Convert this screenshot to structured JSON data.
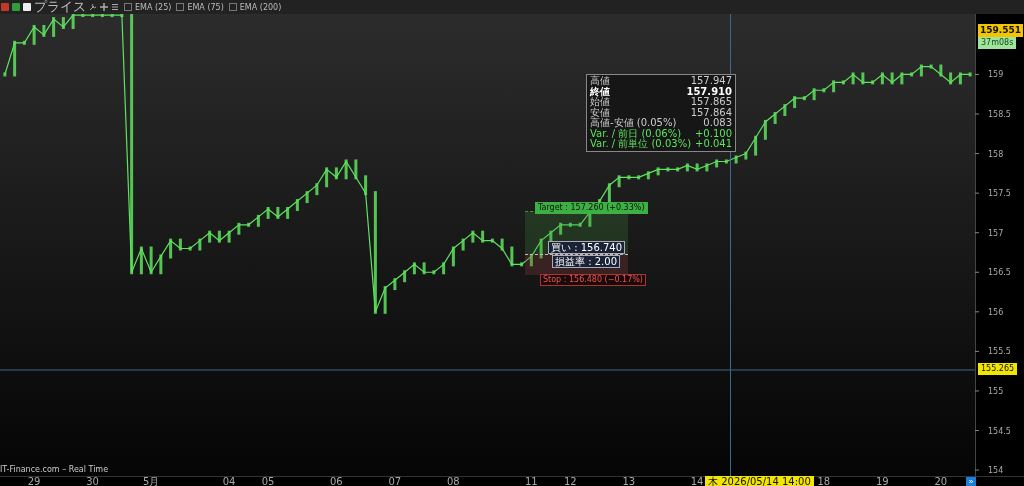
{
  "toolbar": {
    "indicators": [
      {
        "label": "EMA (25)",
        "checked": false
      },
      {
        "label": "EMA (75)",
        "checked": false
      },
      {
        "label": "EMA (200)",
        "checked": false
      }
    ]
  },
  "chart": {
    "chart_data": {
      "type": "line",
      "ylim": [
        153.925,
        159.764
      ],
      "ref_lines": [
        {
          "axis": "y",
          "value": 155.265
        }
      ],
      "yticks": [
        154,
        154.5,
        155,
        155.5,
        156,
        156.5,
        157,
        157.5,
        158,
        158.5,
        159
      ],
      "categories": [
        null,
        null,
        null,
        "29",
        null,
        null,
        null,
        null,
        null,
        "30",
        null,
        null,
        null,
        null,
        null,
        "5月",
        null,
        null,
        null,
        null,
        null,
        null,
        null,
        "04",
        null,
        null,
        null,
        "05",
        null,
        null,
        null,
        null,
        null,
        null,
        "06",
        null,
        null,
        null,
        null,
        null,
        "07",
        null,
        null,
        null,
        null,
        null,
        "08",
        null,
        null,
        null,
        null,
        null,
        null,
        null,
        "11",
        null,
        null,
        null,
        "12",
        null,
        null,
        null,
        null,
        null,
        "13",
        null,
        null,
        null,
        null,
        null,
        null,
        "14",
        null,
        null,
        null,
        null,
        null,
        null,
        null,
        null,
        null,
        null,
        null,
        null,
        "18",
        null,
        null,
        null,
        null,
        null,
        "19",
        null,
        null,
        null,
        null,
        null,
        "20",
        null,
        null,
        null
      ],
      "series": [
        {
          "name": "プライス",
          "color": "#5ee35e",
          "values": [
            159.0,
            159.4,
            159.4,
            159.6,
            159.5,
            159.7,
            159.6,
            159.75,
            159.75,
            159.75,
            159.75,
            159.75,
            159.75,
            156.5,
            156.8,
            156.5,
            156.7,
            156.9,
            156.8,
            156.8,
            156.9,
            157.0,
            156.9,
            157.0,
            157.1,
            157.1,
            157.2,
            157.3,
            157.2,
            157.3,
            157.4,
            157.5,
            157.6,
            157.8,
            157.7,
            157.9,
            157.7,
            157.5,
            156.0,
            156.3,
            156.4,
            156.5,
            156.6,
            156.5,
            156.5,
            156.6,
            156.8,
            156.9,
            157.0,
            156.9,
            156.9,
            156.8,
            156.6,
            156.6,
            156.7,
            156.9,
            157.0,
            157.1,
            157.1,
            157.1,
            157.26,
            157.4,
            157.6,
            157.7,
            157.7,
            157.7,
            157.75,
            157.8,
            157.8,
            157.8,
            157.85,
            157.8,
            157.85,
            157.9,
            157.9,
            157.95,
            158.0,
            158.2,
            158.4,
            158.5,
            158.6,
            158.7,
            158.7,
            158.8,
            158.8,
            158.9,
            158.9,
            159.0,
            158.9,
            158.9,
            159.0,
            158.9,
            159.0,
            159.0,
            159.1,
            159.1,
            159.0,
            158.9,
            159.0,
            159.0
          ]
        }
      ]
    },
    "last_price": {
      "value": "159.551",
      "countdown": "37m08s"
    },
    "crosshair": {
      "price": "155.265",
      "time": "木 2026/05/14 14:00"
    },
    "position": {
      "target": "Target : 157.260 (+0.33%)",
      "entry": "買い : 156.740",
      "ratio": "損益率 : 2.00",
      "stop": "Stop : 156.480 (−0.17%)"
    },
    "tooltip": {
      "rows": [
        {
          "label": "高値",
          "value": "157.947",
          "kind": "plain"
        },
        {
          "label": "終値",
          "value": "157.910",
          "kind": "bold"
        },
        {
          "label": "始値",
          "value": "157.865",
          "kind": "plain"
        },
        {
          "label": "安値",
          "value": "157.864",
          "kind": "plain"
        },
        {
          "label": "高値-安値 (0.05%)",
          "value": "0.083",
          "kind": "plain"
        },
        {
          "label": "Var. / 前日 (0.06%)",
          "value": "+0.100",
          "kind": "change"
        },
        {
          "label": "Var. / 前単位 (0.03%)",
          "value": "+0.041",
          "kind": "change"
        }
      ]
    },
    "source": "IT-Finance.com – Real Time",
    "scroll_button": "»"
  }
}
